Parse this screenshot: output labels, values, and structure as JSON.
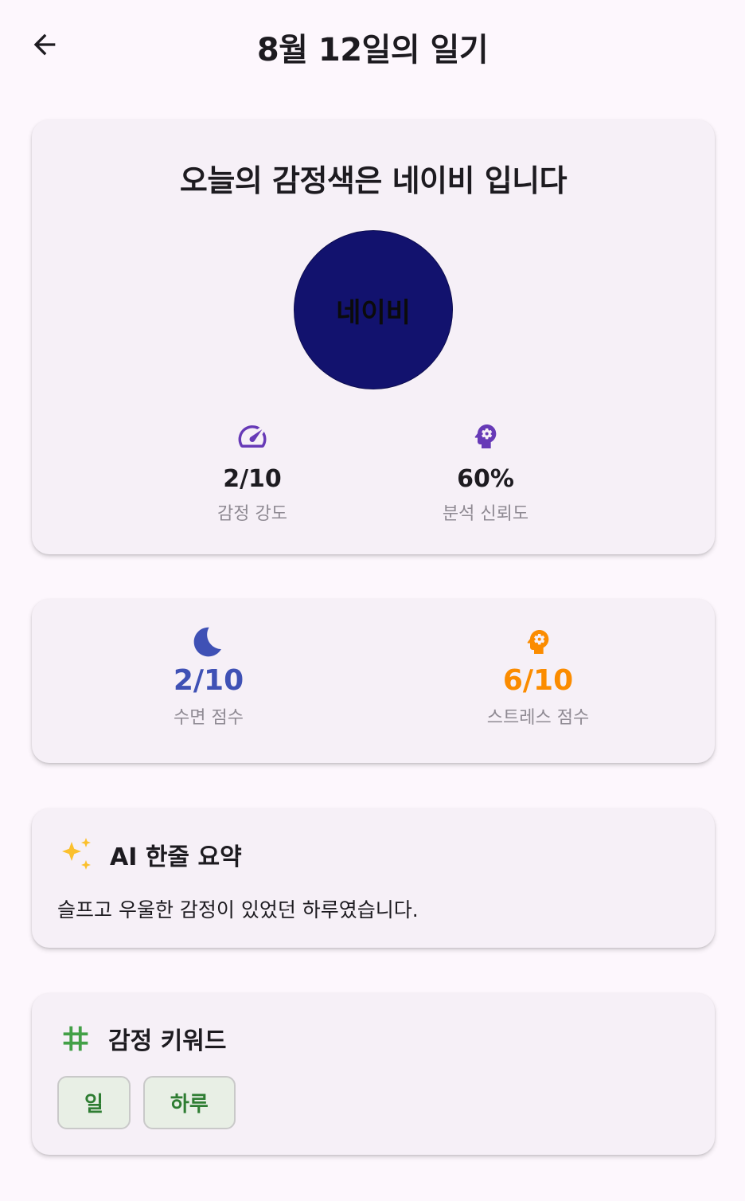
{
  "appbar": {
    "title": "8월 12일의 일기"
  },
  "emotion": {
    "heading": "오늘의 감정색은 네이비 입니다",
    "color_name": "네이비",
    "color_hex": "#12126e",
    "intensity": {
      "value": "2/10",
      "label": "감정 강도",
      "icon": "speedometer-icon"
    },
    "confidence": {
      "value": "60%",
      "label": "분석 신뢰도",
      "icon": "psychology-icon"
    }
  },
  "scores": {
    "sleep": {
      "value": "2/10",
      "label": "수면 점수",
      "icon": "moon-icon",
      "color": "#3f51b5"
    },
    "stress": {
      "value": "6/10",
      "label": "스트레스 점수",
      "icon": "psychology-icon",
      "color": "#fb8c00"
    }
  },
  "summary": {
    "title": "AI 한줄 요약",
    "icon": "sparkles-icon",
    "text": "슬프고 우울한 감정이 있었던 하루였습니다."
  },
  "keywords": {
    "title": "감정 키워드",
    "icon": "hashtag-icon",
    "items": [
      "일",
      "하루"
    ]
  },
  "colors": {
    "accent_purple": "#673ab7",
    "keyword_green": "#2e7d32",
    "sparkle_yellow": "#fbc02d"
  }
}
